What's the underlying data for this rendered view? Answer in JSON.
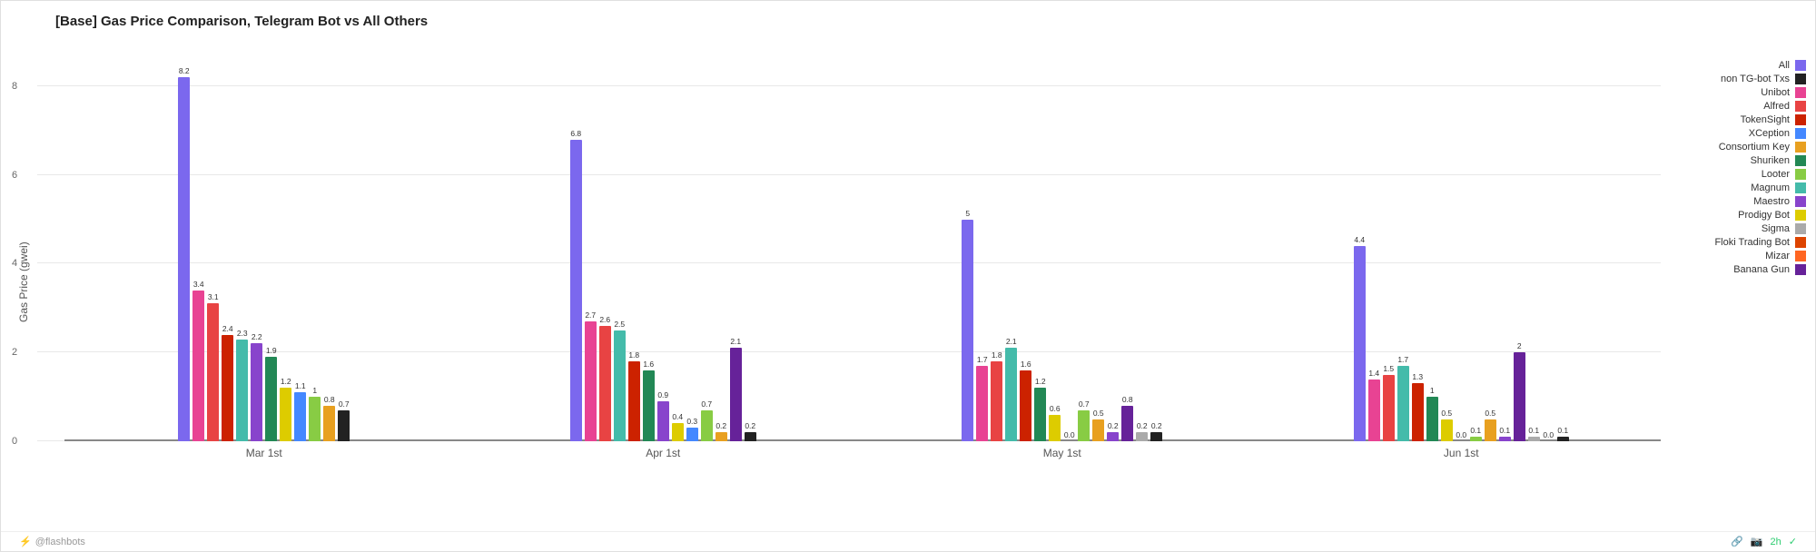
{
  "title": "[Base] Gas Price Comparison, Telegram Bot vs All Others",
  "y_axis_label": "Gas Price (gwei)",
  "x_labels": [
    "Mar 1st",
    "Apr 1st",
    "May 1st",
    "Jun 1st"
  ],
  "footer": {
    "attribution": "@flashbots",
    "time_label": "2h"
  },
  "legend": [
    {
      "label": "All",
      "color": "#7b68ee"
    },
    {
      "label": "non TG-bot Txs",
      "color": "#222222"
    },
    {
      "label": "Unibot",
      "color": "#e84393"
    },
    {
      "label": "Alfred",
      "color": "#e84343"
    },
    {
      "label": "TokenSight",
      "color": "#cc2200"
    },
    {
      "label": "XCeption",
      "color": "#4488ff"
    },
    {
      "label": "Consortium Key",
      "color": "#e8a020"
    },
    {
      "label": "Shuriken",
      "color": "#228855"
    },
    {
      "label": "Looter",
      "color": "#88cc44"
    },
    {
      "label": "Magnum",
      "color": "#44bbaa"
    },
    {
      "label": "Maestro",
      "color": "#8844cc"
    },
    {
      "label": "Prodigy Bot",
      "color": "#ddcc00"
    },
    {
      "label": "Sigma",
      "color": "#aaaaaa"
    },
    {
      "label": "Floki Trading Bot",
      "color": "#dd4400"
    },
    {
      "label": "Mizar",
      "color": "#ff6622"
    },
    {
      "label": "Banana Gun",
      "color": "#662299"
    }
  ],
  "groups": [
    {
      "label": "Mar 1st",
      "bars": [
        {
          "value": 8.2,
          "color": "#7b68ee"
        },
        {
          "value": 3.4,
          "color": "#e84393"
        },
        {
          "value": 3.1,
          "color": "#e84343"
        },
        {
          "value": 2.4,
          "color": "#cc2200"
        },
        {
          "value": 2.3,
          "color": "#44bbaa"
        },
        {
          "value": 2.2,
          "color": "#8844cc"
        },
        {
          "value": 1.9,
          "color": "#228855"
        },
        {
          "value": 1.2,
          "color": "#ddcc00"
        },
        {
          "value": 1.1,
          "color": "#4488ff"
        },
        {
          "value": 1.0,
          "color": "#88cc44"
        },
        {
          "value": 0.8,
          "color": "#e8a020"
        },
        {
          "value": 0.7,
          "color": "#222222"
        }
      ]
    },
    {
      "label": "Apr 1st",
      "bars": [
        {
          "value": 6.8,
          "color": "#7b68ee"
        },
        {
          "value": 2.7,
          "color": "#e84393"
        },
        {
          "value": 2.6,
          "color": "#e84343"
        },
        {
          "value": 2.5,
          "color": "#44bbaa"
        },
        {
          "value": 1.8,
          "color": "#cc2200"
        },
        {
          "value": 1.6,
          "color": "#228855"
        },
        {
          "value": 0.9,
          "color": "#8844cc"
        },
        {
          "value": 0.4,
          "color": "#ddcc00"
        },
        {
          "value": 0.3,
          "color": "#4488ff"
        },
        {
          "value": 0.7,
          "color": "#88cc44"
        },
        {
          "value": 0.2,
          "color": "#e8a020"
        },
        {
          "value": 2.1,
          "color": "#662299"
        },
        {
          "value": 0.2,
          "color": "#222222"
        }
      ]
    },
    {
      "label": "May 1st",
      "bars": [
        {
          "value": 5.0,
          "color": "#7b68ee"
        },
        {
          "value": 1.7,
          "color": "#e84393"
        },
        {
          "value": 1.8,
          "color": "#e84343"
        },
        {
          "value": 2.1,
          "color": "#44bbaa"
        },
        {
          "value": 1.6,
          "color": "#cc2200"
        },
        {
          "value": 1.2,
          "color": "#228855"
        },
        {
          "value": 0.6,
          "color": "#ddcc00"
        },
        {
          "value": 0.0,
          "color": "#4488ff"
        },
        {
          "value": 0.7,
          "color": "#88cc44"
        },
        {
          "value": 0.5,
          "color": "#e8a020"
        },
        {
          "value": 0.2,
          "color": "#8844cc"
        },
        {
          "value": 0.8,
          "color": "#662299"
        },
        {
          "value": 0.2,
          "color": "#aaaaaa"
        },
        {
          "value": 0.2,
          "color": "#222222"
        }
      ]
    },
    {
      "label": "Jun 1st",
      "bars": [
        {
          "value": 4.4,
          "color": "#7b68ee"
        },
        {
          "value": 1.4,
          "color": "#e84393"
        },
        {
          "value": 1.5,
          "color": "#e84343"
        },
        {
          "value": 1.7,
          "color": "#44bbaa"
        },
        {
          "value": 1.3,
          "color": "#cc2200"
        },
        {
          "value": 1.0,
          "color": "#228855"
        },
        {
          "value": 0.5,
          "color": "#ddcc00"
        },
        {
          "value": 0.0,
          "color": "#4488ff"
        },
        {
          "value": 0.1,
          "color": "#88cc44"
        },
        {
          "value": 0.5,
          "color": "#e8a020"
        },
        {
          "value": 0.1,
          "color": "#8844cc"
        },
        {
          "value": 2.0,
          "color": "#662299"
        },
        {
          "value": 0.1,
          "color": "#aaaaaa"
        },
        {
          "value": 0.0,
          "color": "#dd4400"
        },
        {
          "value": 0.1,
          "color": "#222222"
        }
      ]
    }
  ],
  "y_ticks": [
    0,
    2,
    4,
    6,
    8
  ],
  "y_max": 9
}
